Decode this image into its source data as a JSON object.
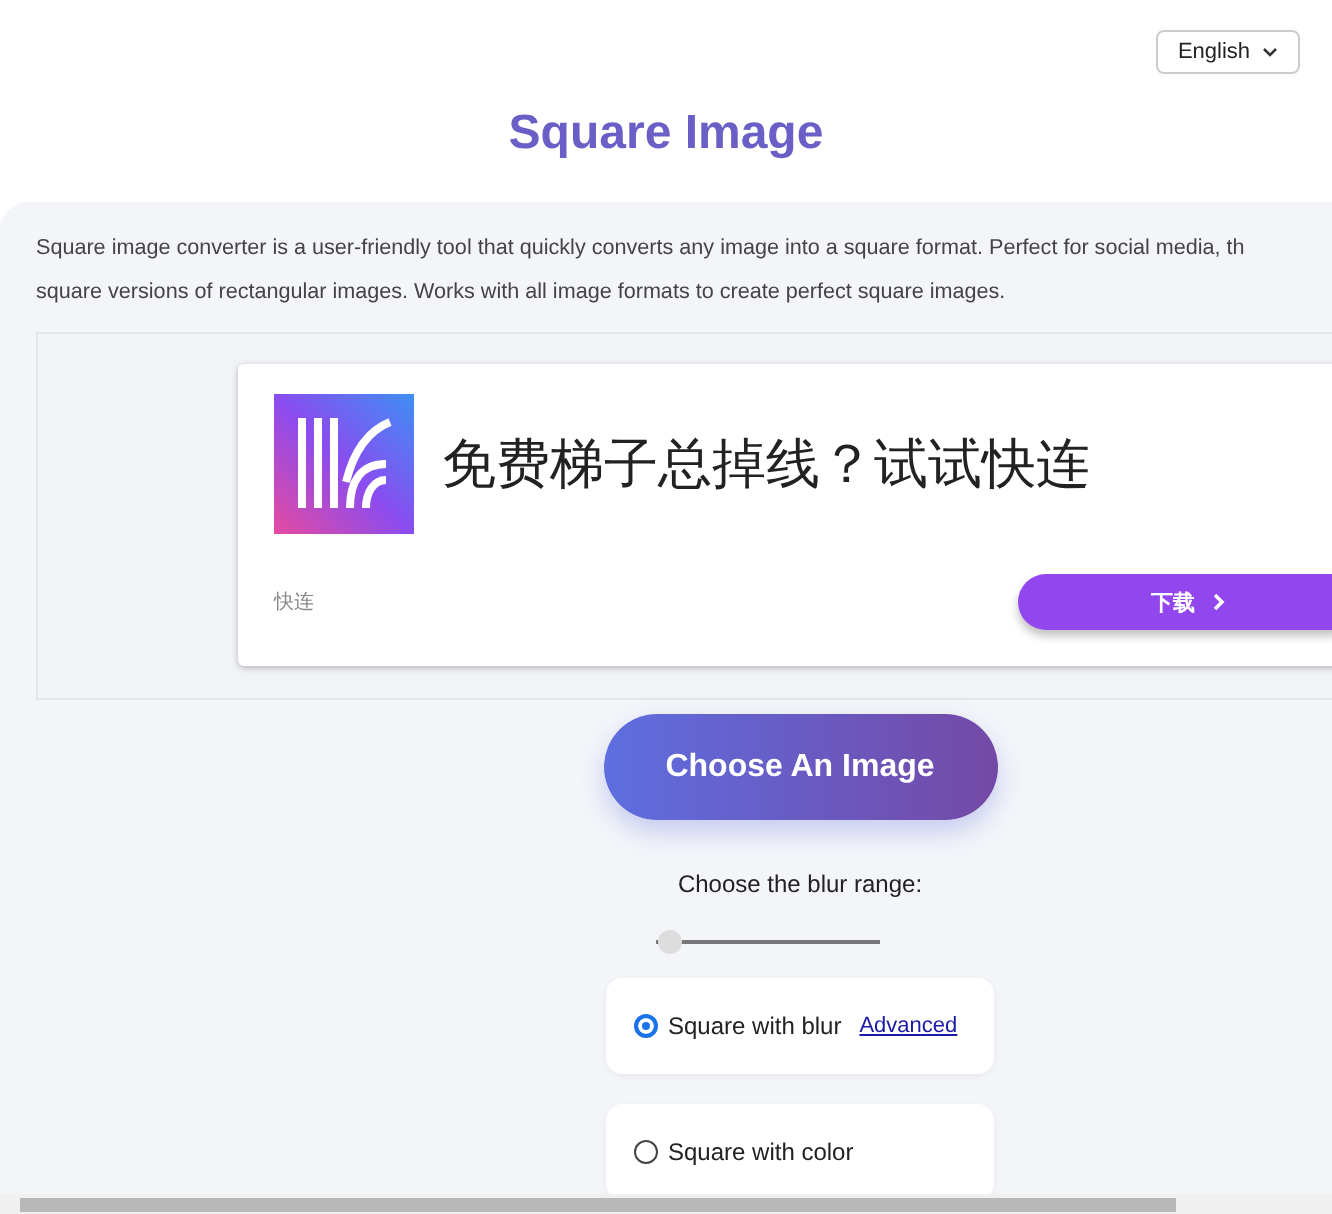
{
  "language_selector": {
    "value": "English"
  },
  "title": "Square Image",
  "description_lines": [
    "Square image converter is a user-friendly tool that quickly converts any image into a square format. Perfect for social media, th",
    "square versions of rectangular images. Works with all image formats to create perfect square images."
  ],
  "ad": {
    "headline": "免费梯子总掉线？试试快连",
    "brand": "快连",
    "button": "下载"
  },
  "choose_button": "Choose An Image",
  "blur_label": "Choose the blur range:",
  "blur_slider": {
    "level": 0.03
  },
  "options": [
    {
      "label": "Square with blur",
      "selected": true,
      "link": "Advanced"
    },
    {
      "label": "Square with color",
      "selected": false
    }
  ]
}
